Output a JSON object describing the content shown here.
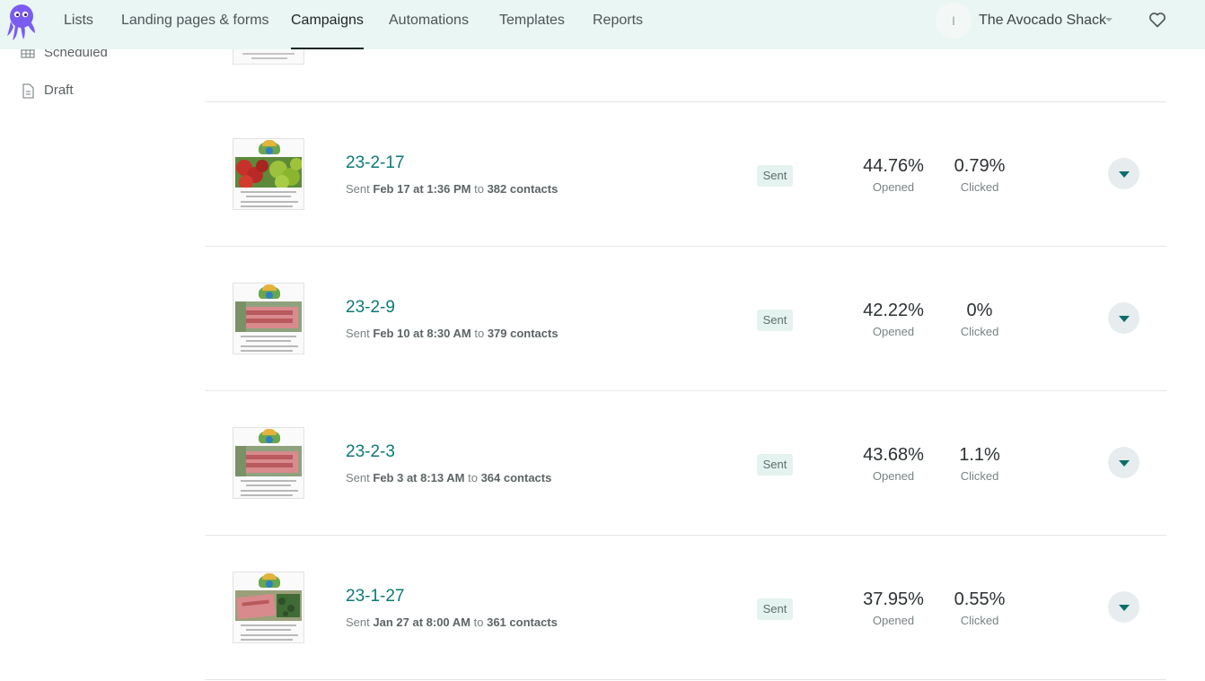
{
  "nav": {
    "items": [
      {
        "label": "Lists"
      },
      {
        "label": "Landing pages & forms"
      },
      {
        "label": "Campaigns"
      },
      {
        "label": "Automations"
      },
      {
        "label": "Templates"
      },
      {
        "label": "Reports"
      }
    ],
    "active": "Campaigns",
    "avatar_initial": "I",
    "account_name": "The Avocado Shack"
  },
  "sidebar": {
    "items": [
      {
        "label": "Scheduled",
        "icon": "calendar-grid-icon"
      },
      {
        "label": "Draft",
        "icon": "document-icon"
      }
    ]
  },
  "campaigns": [
    {
      "name": "23-2-17",
      "sent_prefix": "Sent",
      "date": "Feb 17 at 1:36 PM",
      "to": "to",
      "contacts": "382 contacts",
      "status": "Sent",
      "opened": "44.76%",
      "opened_label": "Opened",
      "clicked": "0.79%",
      "clicked_label": "Clicked"
    },
    {
      "name": "23-2-9",
      "sent_prefix": "Sent",
      "date": "Feb 10 at 8:30 AM",
      "to": "to",
      "contacts": "379 contacts",
      "status": "Sent",
      "opened": "42.22%",
      "opened_label": "Opened",
      "clicked": "0%",
      "clicked_label": "Clicked"
    },
    {
      "name": "23-2-3",
      "sent_prefix": "Sent",
      "date": "Feb 3 at 8:13 AM",
      "to": "to",
      "contacts": "364 contacts",
      "status": "Sent",
      "opened": "43.68%",
      "opened_label": "Opened",
      "clicked": "1.1%",
      "clicked_label": "Clicked"
    },
    {
      "name": "23-1-27",
      "sent_prefix": "Sent",
      "date": "Jan 27 at 8:00 AM",
      "to": "to",
      "contacts": "361 contacts",
      "status": "Sent",
      "opened": "37.95%",
      "opened_label": "Opened",
      "clicked": "0.55%",
      "clicked_label": "Clicked"
    }
  ],
  "colors": {
    "topbar_bg": "#eaf6f3",
    "accent_teal": "#0b7a75",
    "badge_bg": "#e4f3ef",
    "logo_purple": "#7b5cf0"
  }
}
